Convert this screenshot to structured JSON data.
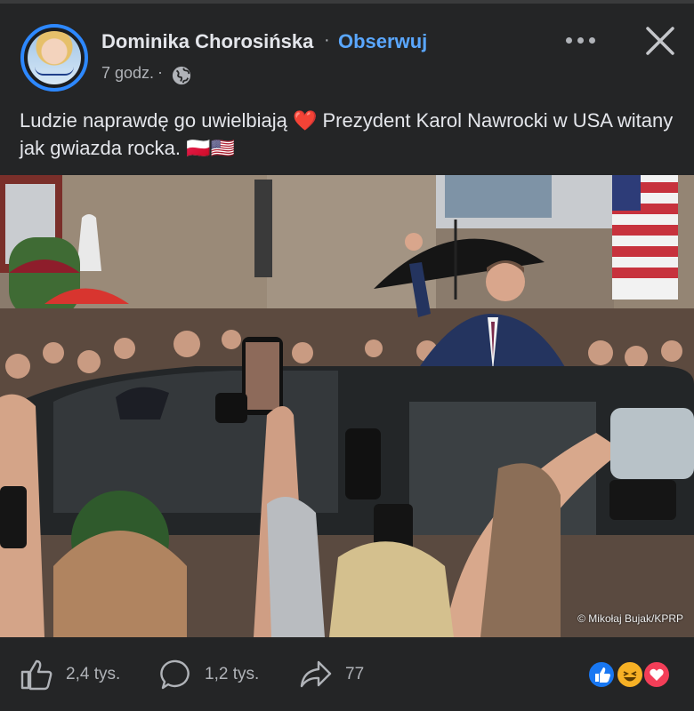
{
  "post": {
    "author": "Dominika Chorosińska",
    "separator": "·",
    "follow_label": "Obserwuj",
    "time": "7 godz.",
    "time_separator": "·",
    "text": "Ludzie naprawdę go uwielbiają ❤️ Prezydent Karol Nawrocki w USA witany jak gwiazda rocka. 🇵🇱🇺🇸",
    "photo_credit": "© Mikołaj Bujak/KPRP"
  },
  "icons": {
    "privacy": "globe-icon",
    "more": "more-icon",
    "close": "close-icon",
    "like": "thumbs-up-icon",
    "comment": "comment-icon",
    "share": "share-icon"
  },
  "actions": {
    "likes": "2,4 tys.",
    "comments": "1,2 tys.",
    "shares": "77"
  },
  "reactions": [
    "like",
    "haha",
    "love"
  ],
  "colors": {
    "background": "#242526",
    "follow": "#5aa7ff",
    "avatar_ring": "#2d88ff",
    "like": "#1877f2",
    "haha": "#f7b125",
    "love": "#f33e58"
  }
}
